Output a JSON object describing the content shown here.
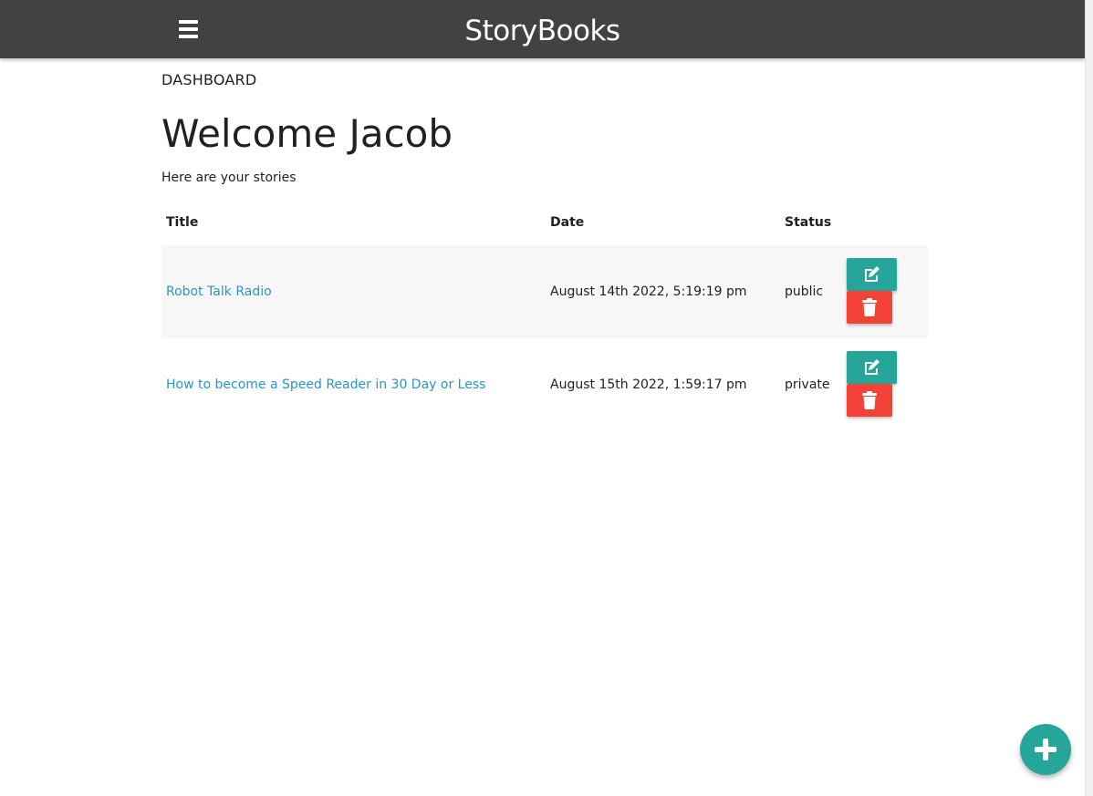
{
  "navbar": {
    "brand": "StoryBooks",
    "menu_icon": "hamburger-menu-icon",
    "background": "#424242"
  },
  "dashboard": {
    "section_label": "DASHBOARD",
    "welcome": "Welcome Jacob",
    "subtitle": "Here are your stories"
  },
  "table": {
    "headers": [
      "Title",
      "Date",
      "Status"
    ],
    "rows": [
      {
        "title": "Robot Talk Radio",
        "date": "August 14th 2022, 5:19:19 pm",
        "status": "public"
      },
      {
        "title": "How to become a Speed Reader in 30 Day or Less",
        "date": "August 15th 2022, 1:59:17 pm",
        "status": "private"
      }
    ]
  },
  "icons": {
    "edit": "edit-icon",
    "delete": "trash-icon",
    "add": "plus-icon"
  },
  "colors": {
    "link": "#2796c9",
    "edit_button": "#26a69a",
    "delete_button": "#f44336",
    "fab": "#26a69a",
    "row_stripe": "#f7f7f7"
  }
}
